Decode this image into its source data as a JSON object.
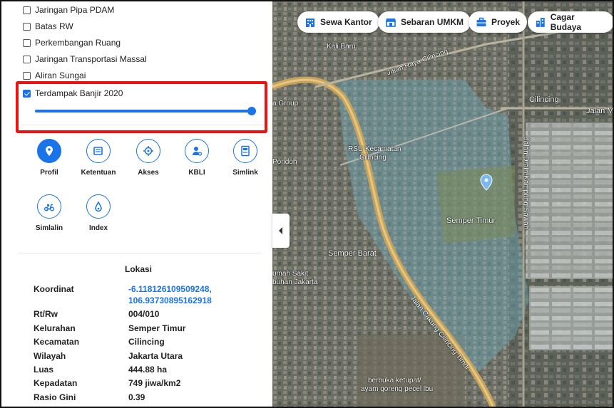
{
  "layers": [
    {
      "label": "Jaringan Pipa PDAM",
      "checked": false
    },
    {
      "label": "Batas RW",
      "checked": false
    },
    {
      "label": "Perkembangan Ruang",
      "checked": false
    },
    {
      "label": "Jaringan Transportasi Massal",
      "checked": false
    },
    {
      "label": "Aliran Sungai",
      "checked": false
    },
    {
      "label": "Terdampak Banjir 2020",
      "checked": true,
      "opacity": 1.0
    }
  ],
  "tools": [
    {
      "label": "Profil",
      "icon": "pin-icon",
      "active": true
    },
    {
      "label": "Ketentuan",
      "icon": "book-icon",
      "active": false
    },
    {
      "label": "Akses",
      "icon": "crosshair-icon",
      "active": false
    },
    {
      "label": "KBLI",
      "icon": "person-pin-icon",
      "active": false
    },
    {
      "label": "Simlink",
      "icon": "document-icon",
      "active": false
    },
    {
      "label": "Simlalin",
      "icon": "scooter-icon",
      "active": false
    },
    {
      "label": "Index",
      "icon": "drop-icon",
      "active": false
    }
  ],
  "lokasi": {
    "title": "Lokasi",
    "koordinat_label": "Koordinat",
    "koordinat_line1": "-6.118126109509248,",
    "koordinat_line2": "106.93730895162918",
    "rows": [
      {
        "label": "Rt/Rw",
        "value": "004/010"
      },
      {
        "label": "Kelurahan",
        "value": "Semper Timur"
      },
      {
        "label": "Kecamatan",
        "value": "Cilincing"
      },
      {
        "label": "Wilayah",
        "value": "Jakarta Utara"
      },
      {
        "label": "Luas",
        "value": "444.88 ha"
      },
      {
        "label": "Kepadatan",
        "value": "749 jiwa/km2"
      },
      {
        "label": "Rasio Gini",
        "value": "0.39"
      }
    ]
  },
  "map_chips": [
    {
      "label": "Sewa Kantor",
      "icon": "building-icon"
    },
    {
      "label": "Sebaran UMKM",
      "icon": "store-icon"
    },
    {
      "label": "Proyek",
      "icon": "briefcase-icon"
    },
    {
      "label": "Cagar Budaya",
      "icon": "heritage-building-icon"
    }
  ],
  "map_labels": {
    "kali_baru": "Kali Baru",
    "jalan_raya_cilincing": "Jalan Raya Cilincing",
    "group": "a Group",
    "rsu": "RSU Kecamatan",
    "rsu2": "Cilincing",
    "pondoh": "Pondoh",
    "cilincing": "Cilincing",
    "jalan_m": "Jalan M",
    "semper_timur": "Semper Timur",
    "semper_barat": "Semper Barat",
    "rs1": "umah Sakit",
    "rs2": "buhan Jakarta",
    "jalan_cakung": "Jalan Cakung Cilincing Timur",
    "jalan_drain": "Jalan Drain Kampung Sawah",
    "berbuka": "berbuka ketupat/",
    "ayam": "ayam goreng pecel lbu"
  },
  "colors": {
    "accent": "#1a73e8",
    "highlight": "#e11111"
  }
}
